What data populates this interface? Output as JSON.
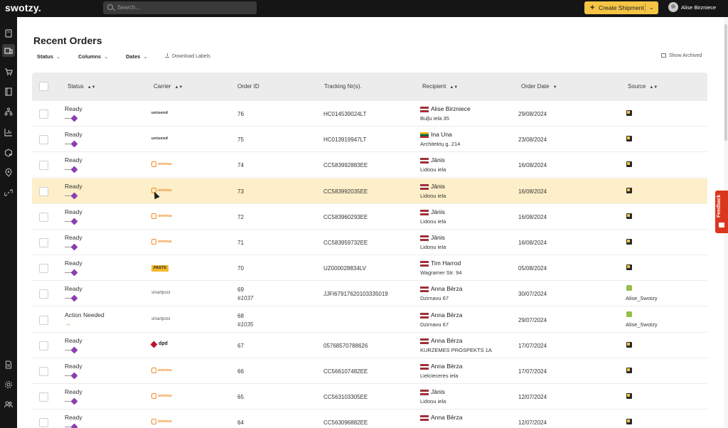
{
  "app": {
    "logo": "swotzy."
  },
  "topbar": {
    "search_placeholder": "Search...",
    "create_label": "Create Shipment",
    "user_name": "Alise Birzniece"
  },
  "sidebar": {
    "items": [
      "pages-icon",
      "shipments-icon",
      "cart-icon",
      "book-icon",
      "network-icon",
      "chart-icon",
      "box-settings-icon",
      "location-icon",
      "link-icon",
      "document-icon",
      "settings-icon",
      "users-icon"
    ]
  },
  "page": {
    "title": "Recent Orders",
    "filters": [
      "Status",
      "Columns",
      "Dates"
    ],
    "download_label": "Download Labels",
    "archived_label": "Show Archived",
    "feedback_label": "Feedback"
  },
  "columns": [
    "Status",
    "Carrier",
    "Order ID",
    "Tracking Nr(s).",
    "Recipient",
    "Order Date",
    "Source"
  ],
  "rows": [
    {
      "status": "Ready",
      "carrier": "unisend",
      "carrier_label": "unisend",
      "order_id": "76",
      "ext_id": "",
      "tracking": "HC014539024LT",
      "flag": "lv",
      "recipient": "Alise Birzniece",
      "address": "Buļļu iela 35",
      "date": "29/08/2024",
      "source": "box",
      "source_name": ""
    },
    {
      "status": "Ready",
      "carrier": "unisend",
      "carrier_label": "unisend",
      "order_id": "75",
      "ext_id": "",
      "tracking": "HC013919947LT",
      "flag": "lt",
      "recipient": "Ina Una",
      "address": "Architektų g. 214",
      "date": "23/08/2024",
      "source": "box",
      "source_name": ""
    },
    {
      "status": "Ready",
      "carrier": "omniva",
      "carrier_label": "omniva",
      "order_id": "74",
      "ext_id": "",
      "tracking": "CC583992883EE",
      "flag": "lv",
      "recipient": "Jānis",
      "address": "Lidoņu iela",
      "date": "16/08/2024",
      "source": "box",
      "source_name": ""
    },
    {
      "status": "Ready",
      "carrier": "omniva",
      "carrier_label": "omniva",
      "order_id": "73",
      "ext_id": "",
      "tracking": "CC583992035EE",
      "flag": "lv",
      "recipient": "Jānis",
      "address": "Lidoņu iela",
      "date": "16/08/2024",
      "source": "box",
      "source_name": ""
    },
    {
      "status": "Ready",
      "carrier": "omniva",
      "carrier_label": "omniva",
      "order_id": "72",
      "ext_id": "",
      "tracking": "CC583960293EE",
      "flag": "lv",
      "recipient": "Jānis",
      "address": "Lidoņu iela",
      "date": "16/08/2024",
      "source": "box",
      "source_name": ""
    },
    {
      "status": "Ready",
      "carrier": "omniva",
      "carrier_label": "omniva",
      "order_id": "71",
      "ext_id": "",
      "tracking": "CC583959732EE",
      "flag": "lv",
      "recipient": "Jānis",
      "address": "Lidoņu iela",
      "date": "16/08/2024",
      "source": "box",
      "source_name": ""
    },
    {
      "status": "Ready",
      "carrier": "pasts",
      "carrier_label": "PASTS",
      "order_id": "70",
      "ext_id": "",
      "tracking": "UZ000028834LV",
      "flag": "lv",
      "recipient": "Tim Harrod",
      "address": "Wagramer Str. 94",
      "date": "05/08/2024",
      "source": "box",
      "source_name": ""
    },
    {
      "status": "Ready",
      "carrier": "smartpost",
      "carrier_label": "smartpost",
      "order_id": "69",
      "ext_id": "#1037",
      "tracking": "JJFI67917620103335019",
      "flag": "lv",
      "recipient": "Anna Bērza",
      "address": "Dzirnavu 67",
      "date": "30/07/2024",
      "source": "shop",
      "source_name": "Alise_Swotzy"
    },
    {
      "status": "Action Needed",
      "carrier": "smartpost",
      "carrier_label": "smartpost",
      "order_id": "68",
      "ext_id": "#1035",
      "tracking": "",
      "flag": "lv",
      "recipient": "Anna Bērza",
      "address": "Dzirnavu 67",
      "date": "29/07/2024",
      "source": "shop",
      "source_name": "Alise_Swotzy"
    },
    {
      "status": "Ready",
      "carrier": "dpd",
      "carrier_label": "dpd",
      "order_id": "67",
      "ext_id": "",
      "tracking": "05768570788626",
      "flag": "lv",
      "recipient": "Anna Bērza",
      "address": "KURZEMES PROSPEKTS 1A",
      "date": "17/07/2024",
      "source": "box",
      "source_name": ""
    },
    {
      "status": "Ready",
      "carrier": "omniva",
      "carrier_label": "omniva",
      "order_id": "66",
      "ext_id": "",
      "tracking": "CC566107482EE",
      "flag": "lv",
      "recipient": "Anna Bērza",
      "address": "Lielcieceres iela",
      "date": "17/07/2024",
      "source": "box",
      "source_name": ""
    },
    {
      "status": "Ready",
      "carrier": "omniva",
      "carrier_label": "omniva",
      "order_id": "65",
      "ext_id": "",
      "tracking": "CC563103305EE",
      "flag": "lv",
      "recipient": "Jānis",
      "address": "Lidoņu iela",
      "date": "12/07/2024",
      "source": "box",
      "source_name": ""
    },
    {
      "status": "Ready",
      "carrier": "omniva",
      "carrier_label": "omniva",
      "order_id": "64",
      "ext_id": "",
      "tracking": "CC563096882EE",
      "flag": "lv",
      "recipient": "Anna Bērza",
      "address": "",
      "date": "12/07/2024",
      "source": "box",
      "source_name": ""
    }
  ],
  "highlight_row": 3,
  "colors": {
    "accent": "#f5c445",
    "highlight": "#fdefc9",
    "status_dot": "#8b3fb0",
    "feedback": "#d9381e"
  }
}
